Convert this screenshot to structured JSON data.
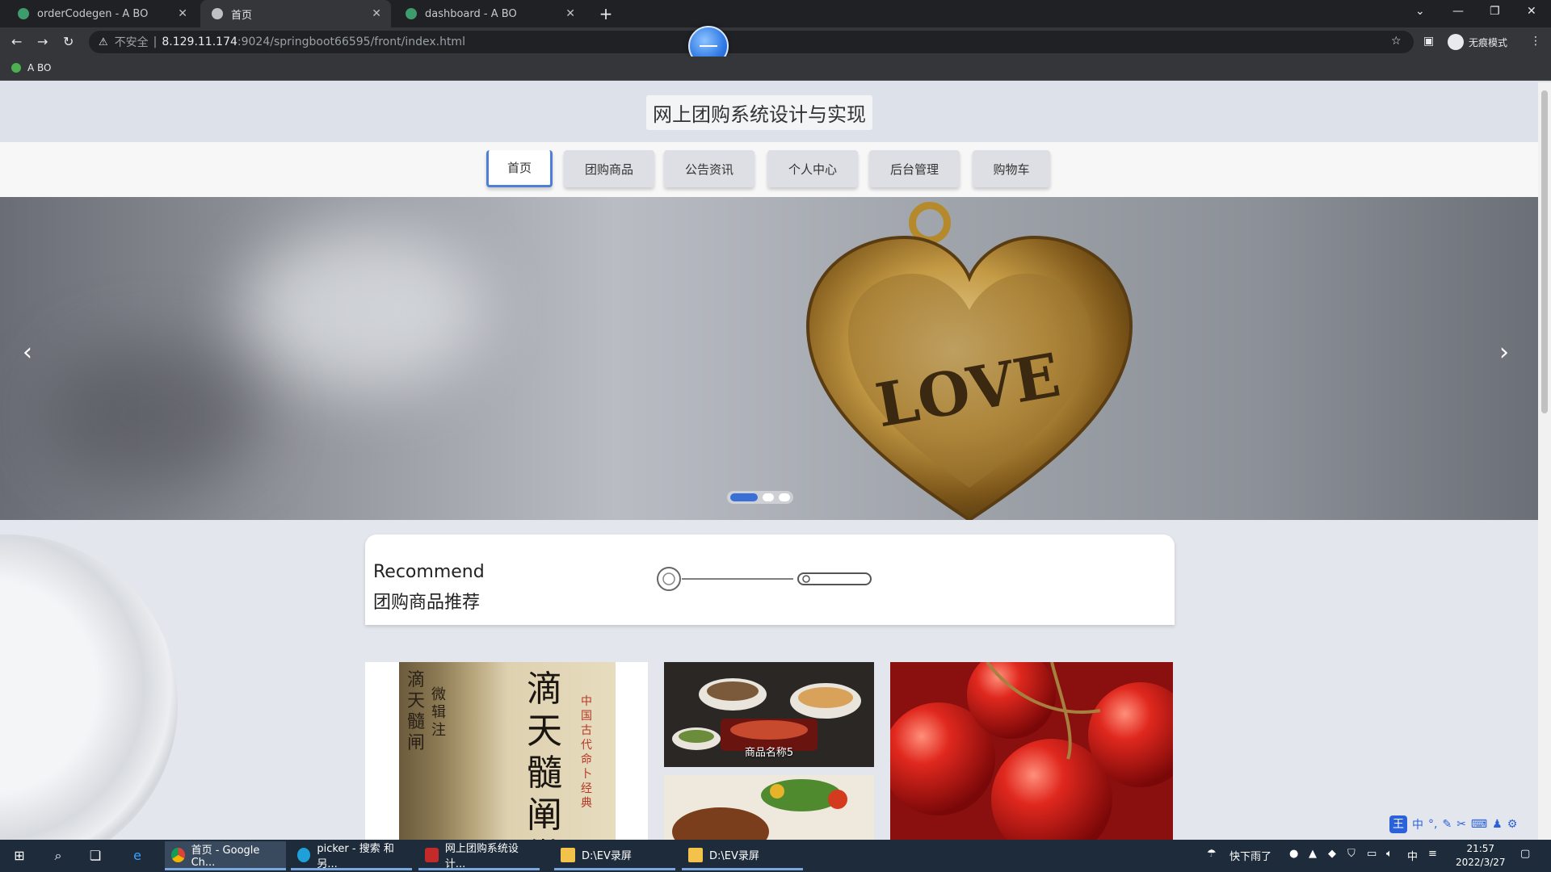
{
  "browser": {
    "tabs": [
      {
        "label": "orderCodegen - A BO",
        "active": false
      },
      {
        "label": "首页",
        "active": true
      },
      {
        "label": "dashboard - A BO",
        "active": false
      }
    ],
    "new_tab": "+",
    "address": {
      "security": "不安全",
      "host": "8.129.11.174",
      "path": ":9024/springboot66595/front/index.html"
    },
    "profile_label": "无痕模式",
    "bookmark": "A BO"
  },
  "site": {
    "title": "网上团购系统设计与实现",
    "nav": [
      {
        "label": "首页",
        "active": true
      },
      {
        "label": "团购商品",
        "active": false
      },
      {
        "label": "公告资讯",
        "active": false
      },
      {
        "label": "个人中心",
        "active": false
      },
      {
        "label": "后台管理",
        "active": false
      },
      {
        "label": "购物车",
        "active": false
      }
    ],
    "banner": {
      "text": "LOVE",
      "prev": "‹",
      "next": "›",
      "slides": 3,
      "current_slide": 1
    },
    "recommend": {
      "title_en": "Recommend",
      "title_cn": "团购商品推荐"
    },
    "products": {
      "book_title": "滴天髓阐微",
      "book_side": "中国古代命卜经典",
      "book_spine": "滴天髓闸",
      "book_spine2": "微辑注",
      "food_caption": "商品名称5"
    }
  },
  "taskbar": {
    "apps": [
      {
        "label": "首页 - Google Ch...",
        "active": true
      },
      {
        "label": "picker - 搜索 和另...",
        "active": false
      },
      {
        "label": "网上团购系统设计...",
        "active": false
      },
      {
        "label": "D:\\EV录屏",
        "active": false
      },
      {
        "label": "D:\\EV录屏",
        "active": false
      }
    ],
    "weather": "快下雨了",
    "ime": "中",
    "time": "21:57",
    "date": "2022/3/27"
  },
  "colors": {
    "accent": "#4f7ed8",
    "taskbar": "#1d2b3a",
    "chrome_dark": "#202124"
  }
}
